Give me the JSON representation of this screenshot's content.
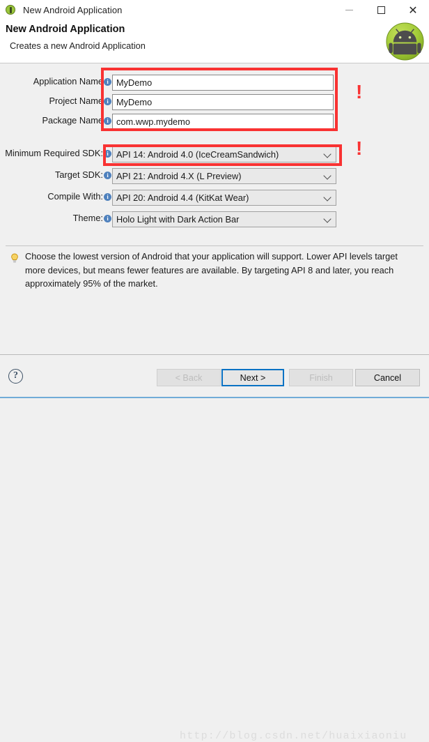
{
  "window": {
    "title": "New Android Application",
    "icon": "android-app-icon",
    "controls": {
      "minimize": "—",
      "maximize": "□",
      "close": "✕"
    }
  },
  "header": {
    "title": "New Android Application",
    "subtitle": "Creates a new Android Application",
    "logo": "android-robot-logo"
  },
  "form": {
    "info_icon_glyph": "i",
    "rows": [
      {
        "label": "Application Name",
        "type": "text",
        "value": "MyDemo",
        "name": "application-name"
      },
      {
        "label": "Project Name",
        "type": "text",
        "value": "MyDemo",
        "name": "project-name"
      },
      {
        "label": "Package Name",
        "type": "text",
        "value": "com.wwp.mydemo",
        "name": "package-name"
      },
      {
        "label": "Minimum Required SDK:",
        "type": "combo",
        "value": "API 14: Android 4.0 (IceCreamSandwich)",
        "name": "minimum-required-sdk"
      },
      {
        "label": "Target SDK:",
        "type": "combo",
        "value": "API 21: Android 4.X (L Preview)",
        "name": "target-sdk"
      },
      {
        "label": "Compile With:",
        "type": "combo",
        "value": "API 20: Android 4.4 (KitKat Wear)",
        "name": "compile-with"
      },
      {
        "label": "Theme:",
        "type": "combo",
        "value": "Holo Light with Dark Action Bar",
        "name": "theme"
      }
    ]
  },
  "annotations": {
    "color": "#f93232",
    "box_names": "names-highlight",
    "box_minsdk": "minimum-sdk-highlight",
    "exclamation": "!"
  },
  "hint": {
    "icon": "lightbulb-icon",
    "text": "Choose the lowest version of Android that your application will support. Lower API levels target more devices, but means fewer features are available. By targeting API 8 and later, you reach approximately 95% of the market."
  },
  "footer": {
    "help_glyph": "?",
    "buttons": [
      {
        "label": "< Back",
        "state": "disabled"
      },
      {
        "label": "Next >",
        "state": "focused"
      },
      {
        "label": "Finish",
        "state": "disabled"
      },
      {
        "label": "Cancel",
        "state": "enabled"
      }
    ]
  },
  "watermark": "http://blog.csdn.net/huaixiaoniu"
}
